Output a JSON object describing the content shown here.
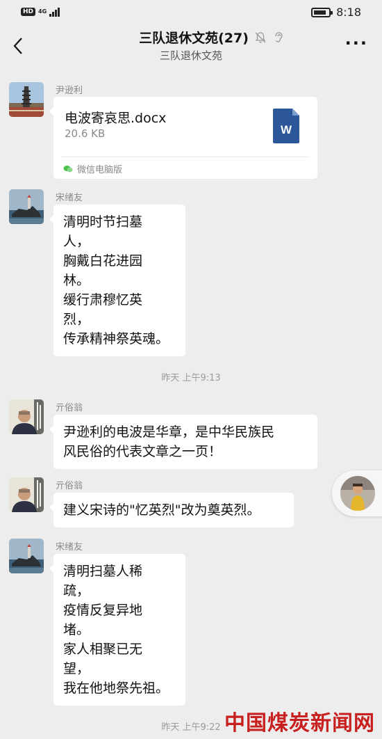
{
  "status_bar": {
    "hd": "HD",
    "network": "4G",
    "signal_bars": 4,
    "battery_level": 0.85,
    "time": "8:18"
  },
  "header": {
    "title": "三队退休文苑(27)",
    "subtitle": "三队退休文苑",
    "back_icon": "chevron-left-icon",
    "mute_icon": "bell-muted-icon",
    "ear_icon": "ear-icon",
    "more_icon": "more-dots-icon",
    "more_label": "···"
  },
  "messages": [
    {
      "sender": "尹逊利",
      "type": "file",
      "file": {
        "name": "电波寄哀思.docx",
        "size": "20.6 KB",
        "source": "微信电脑版",
        "doc_icon_letter": "W"
      }
    },
    {
      "sender": "宋绪友",
      "type": "text",
      "lines": [
        "清明时节扫墓",
        "人，",
        "胸戴白花进园",
        "林。",
        "缓行肃穆忆英",
        "烈，",
        "传承精神祭英魂。"
      ]
    },
    {
      "type": "timestamp",
      "text": "昨天 上午9:13"
    },
    {
      "sender": "亓俗翁",
      "type": "text",
      "lines": [
        "尹逊利的电波是华章，是中华民族民",
        "风民俗的代表文章之一页！"
      ]
    },
    {
      "sender": "亓俗翁",
      "type": "text",
      "lines": [
        "建义宋诗的\"忆英烈\"改为奠英烈。"
      ]
    },
    {
      "sender": "宋绪友",
      "type": "text",
      "lines": [
        "清明扫墓人稀",
        "疏，",
        "疫情反复异地",
        "堵。",
        "家人相聚已无",
        "望，",
        "我在他地祭先祖。"
      ]
    },
    {
      "type": "timestamp",
      "text": "昨天 上午9:22"
    }
  ],
  "watermark": "中国煤炭新闻网",
  "colors": {
    "background": "#ededed",
    "bubble": "#ffffff",
    "doc_blue": "#2b579a",
    "watermark_red": "#c8201e"
  }
}
